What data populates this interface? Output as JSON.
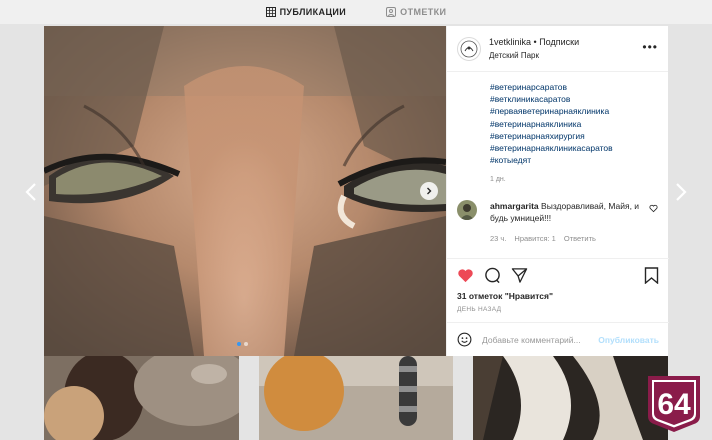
{
  "tabs": [
    {
      "label": "ПУБЛИКАЦИИ",
      "icon": "grid-icon",
      "active": true
    },
    {
      "label": "ОТМЕТКИ",
      "icon": "tag-icon",
      "active": false
    }
  ],
  "post": {
    "username": "1vetklinika",
    "follow_text": "• Подписки",
    "location": "Детский Парк",
    "hashtags": [
      "#ветеринарсаратов",
      "#ветклиникасаратов",
      "#перваяветеринарнаяклиника",
      "#ветеринарнаяклиника",
      "#ветеринарнаяхирургия",
      "#ветеринарнаяклиникасаратов",
      "#котыедят"
    ],
    "caption_time": "1 дн.",
    "comment": {
      "username": "ahmargarita",
      "text": "Выздоравливай, Майя, и будь умницей!!!",
      "time": "23 ч.",
      "likes": "Нравится: 1",
      "reply": "Ответить"
    },
    "likes_count": "31 отметок \"Нравится\"",
    "posted_ago": "ДЕНЬ НАЗАД",
    "add_comment_placeholder": "Добавьте комментарий...",
    "publish_label": "Опубликовать"
  },
  "badge_text": "64",
  "colors": {
    "accent": "#3897f0",
    "like_red": "#ed4956",
    "badge": "#8a1c4a"
  }
}
